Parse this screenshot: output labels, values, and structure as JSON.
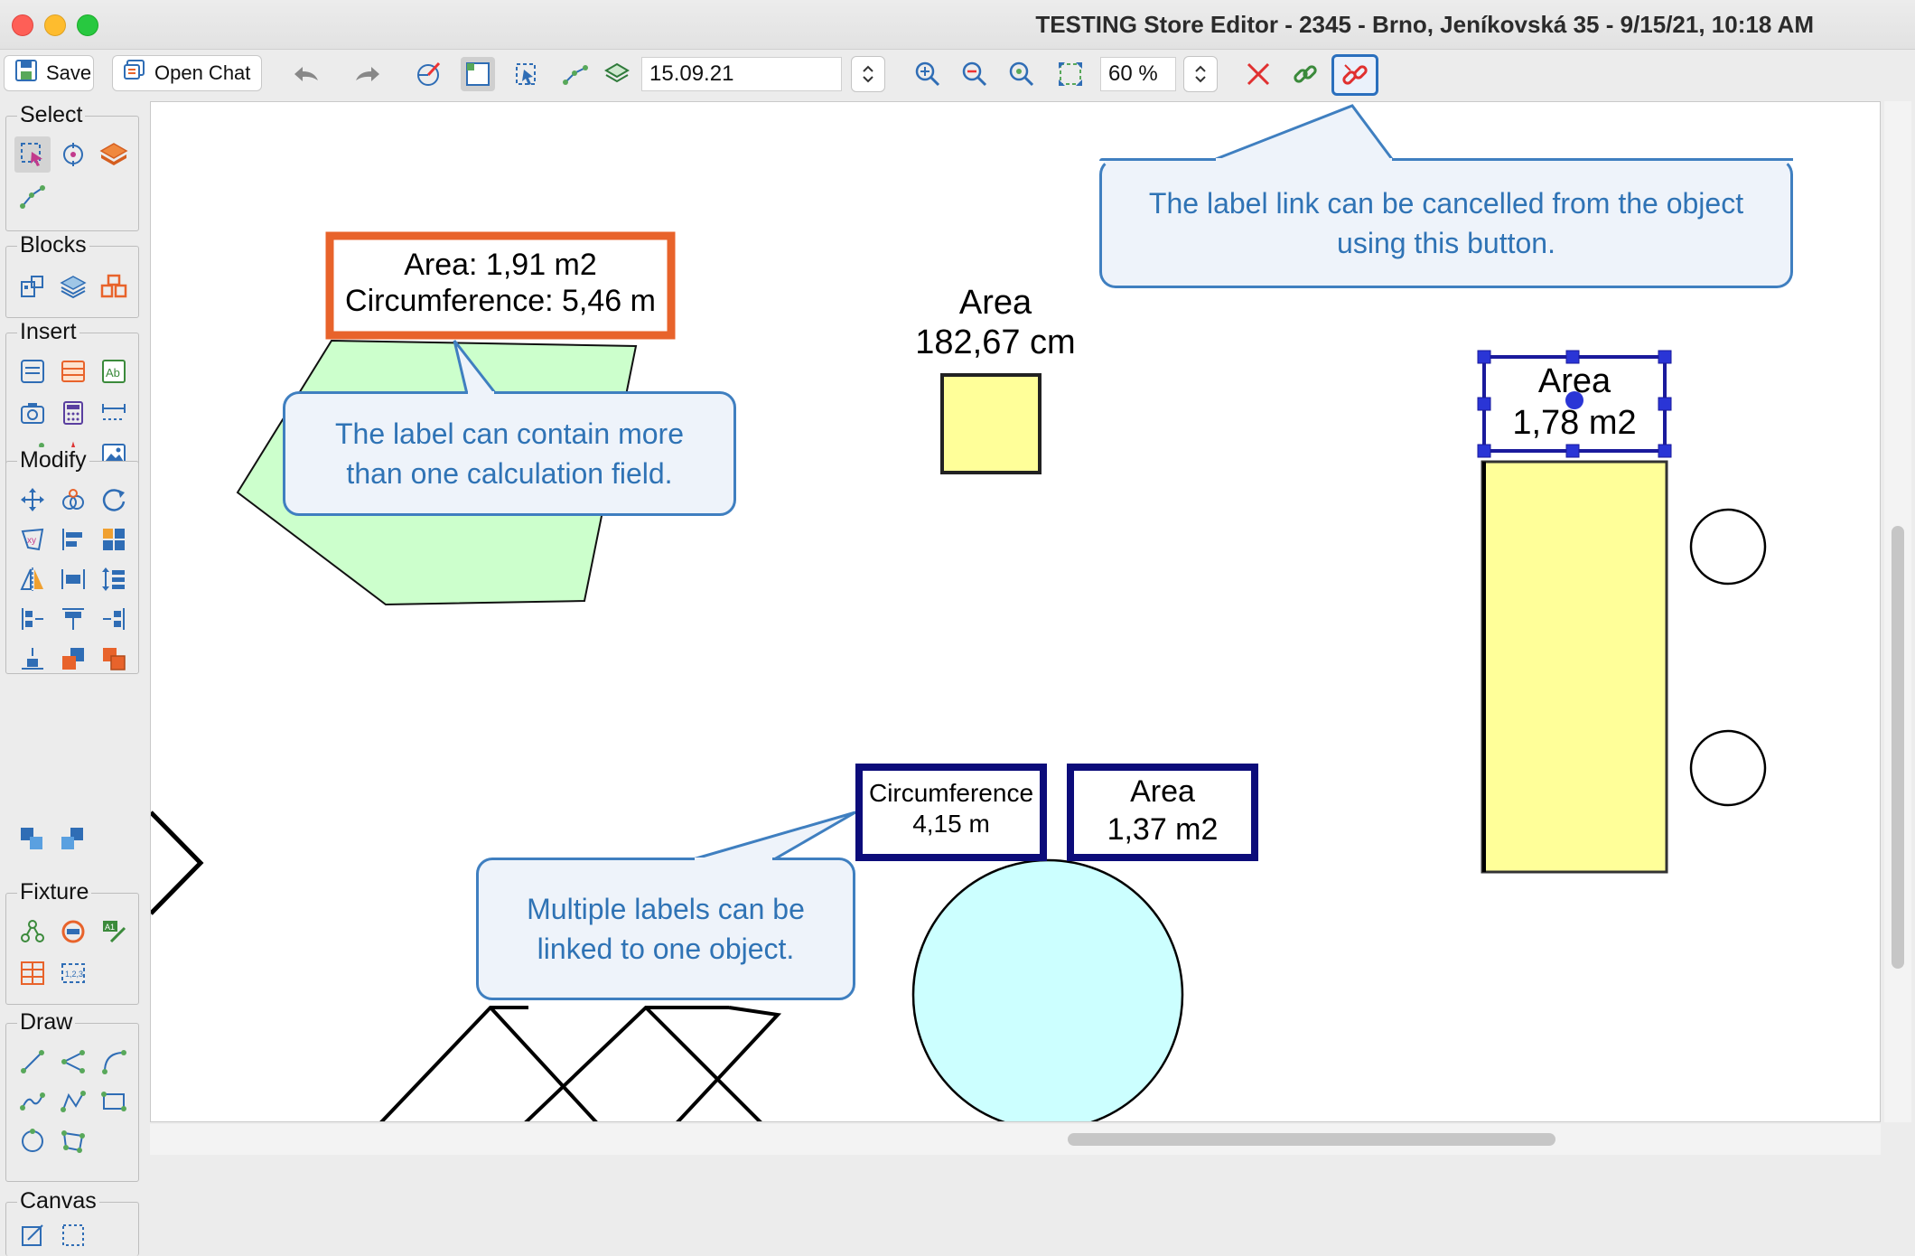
{
  "window": {
    "title": "TESTING Store Editor - 2345 - Brno, Jeníkovská 35 - 9/15/21, 10:18 AM"
  },
  "toolbar": {
    "save_label": "Save",
    "open_chat_label": "Open Chat",
    "date_value": "15.09.21",
    "zoom_value": "60 %"
  },
  "sidebar": {
    "groups": [
      {
        "label": "Select"
      },
      {
        "label": "Blocks"
      },
      {
        "label": "Insert"
      },
      {
        "label": "Modify"
      },
      {
        "label": "Fixture"
      },
      {
        "label": "Draw"
      },
      {
        "label": "Canvas"
      }
    ]
  },
  "canvas": {
    "orange_label": {
      "line1": "Area: 1,91 m2",
      "line2": "Circumference: 5,46 m"
    },
    "square_label": {
      "line1": "Area",
      "line2": "182,67 cm"
    },
    "rect_label": {
      "line1": "Area",
      "line2": "1,78 m2"
    },
    "circ_label": {
      "line1": "Circumference",
      "line2": "4,15 m"
    },
    "area_label": {
      "line1": "Area",
      "line2": "1,37 m2"
    },
    "callouts": {
      "unlink": "The label link can be cancelled from the object using this button.",
      "multi_field": "The label can contain more than one calculation field.",
      "multi_label": "Multiple labels can be linked to one object."
    }
  },
  "colors": {
    "callout_border": "#3f7fc0",
    "callout_text": "#2f73b5",
    "callout_fill": "#eef3fa",
    "orange": "#e8632b",
    "navy": "#0c0c7a",
    "yellow_fill": "#ffff99",
    "green_fill": "#ccffcc",
    "cyan_fill": "#ccffff"
  }
}
